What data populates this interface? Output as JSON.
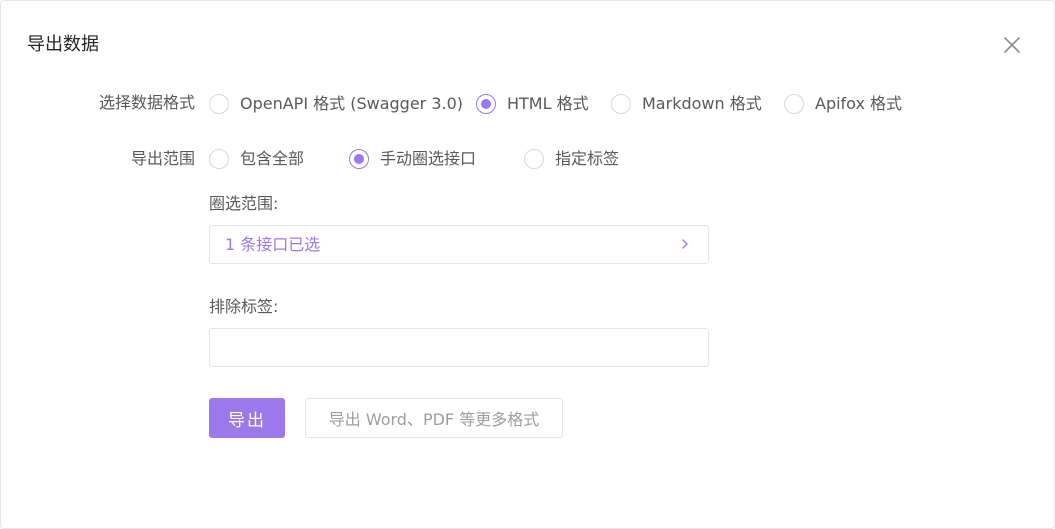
{
  "dialog": {
    "title": "导出数据",
    "close_icon": "close-icon"
  },
  "format": {
    "label": "选择数据格式",
    "selected": "HTML 格式",
    "options": [
      {
        "label": "OpenAPI 格式 (Swagger 3.0)",
        "checked": false
      },
      {
        "label": "HTML 格式",
        "checked": true
      },
      {
        "label": "Markdown 格式",
        "checked": false
      },
      {
        "label": "Apifox 格式",
        "checked": false
      }
    ]
  },
  "scope": {
    "label": "导出范围",
    "selected": "手动圈选接口",
    "options": [
      {
        "label": "包含全部",
        "checked": false
      },
      {
        "label": "手动圈选接口",
        "checked": true
      },
      {
        "label": "指定标签",
        "checked": false
      }
    ]
  },
  "range": {
    "label": "圈选范围:",
    "value": "1 条接口已选",
    "chevron_icon": "chevron-right-icon"
  },
  "exclude": {
    "label": "排除标签:",
    "value": "",
    "placeholder": ""
  },
  "actions": {
    "export_label": "导出",
    "more_formats_label": "导出 Word、PDF 等更多格式"
  },
  "colors": {
    "accent": "#9b79eb",
    "border": "#e6e6e6",
    "text": "#595959"
  }
}
